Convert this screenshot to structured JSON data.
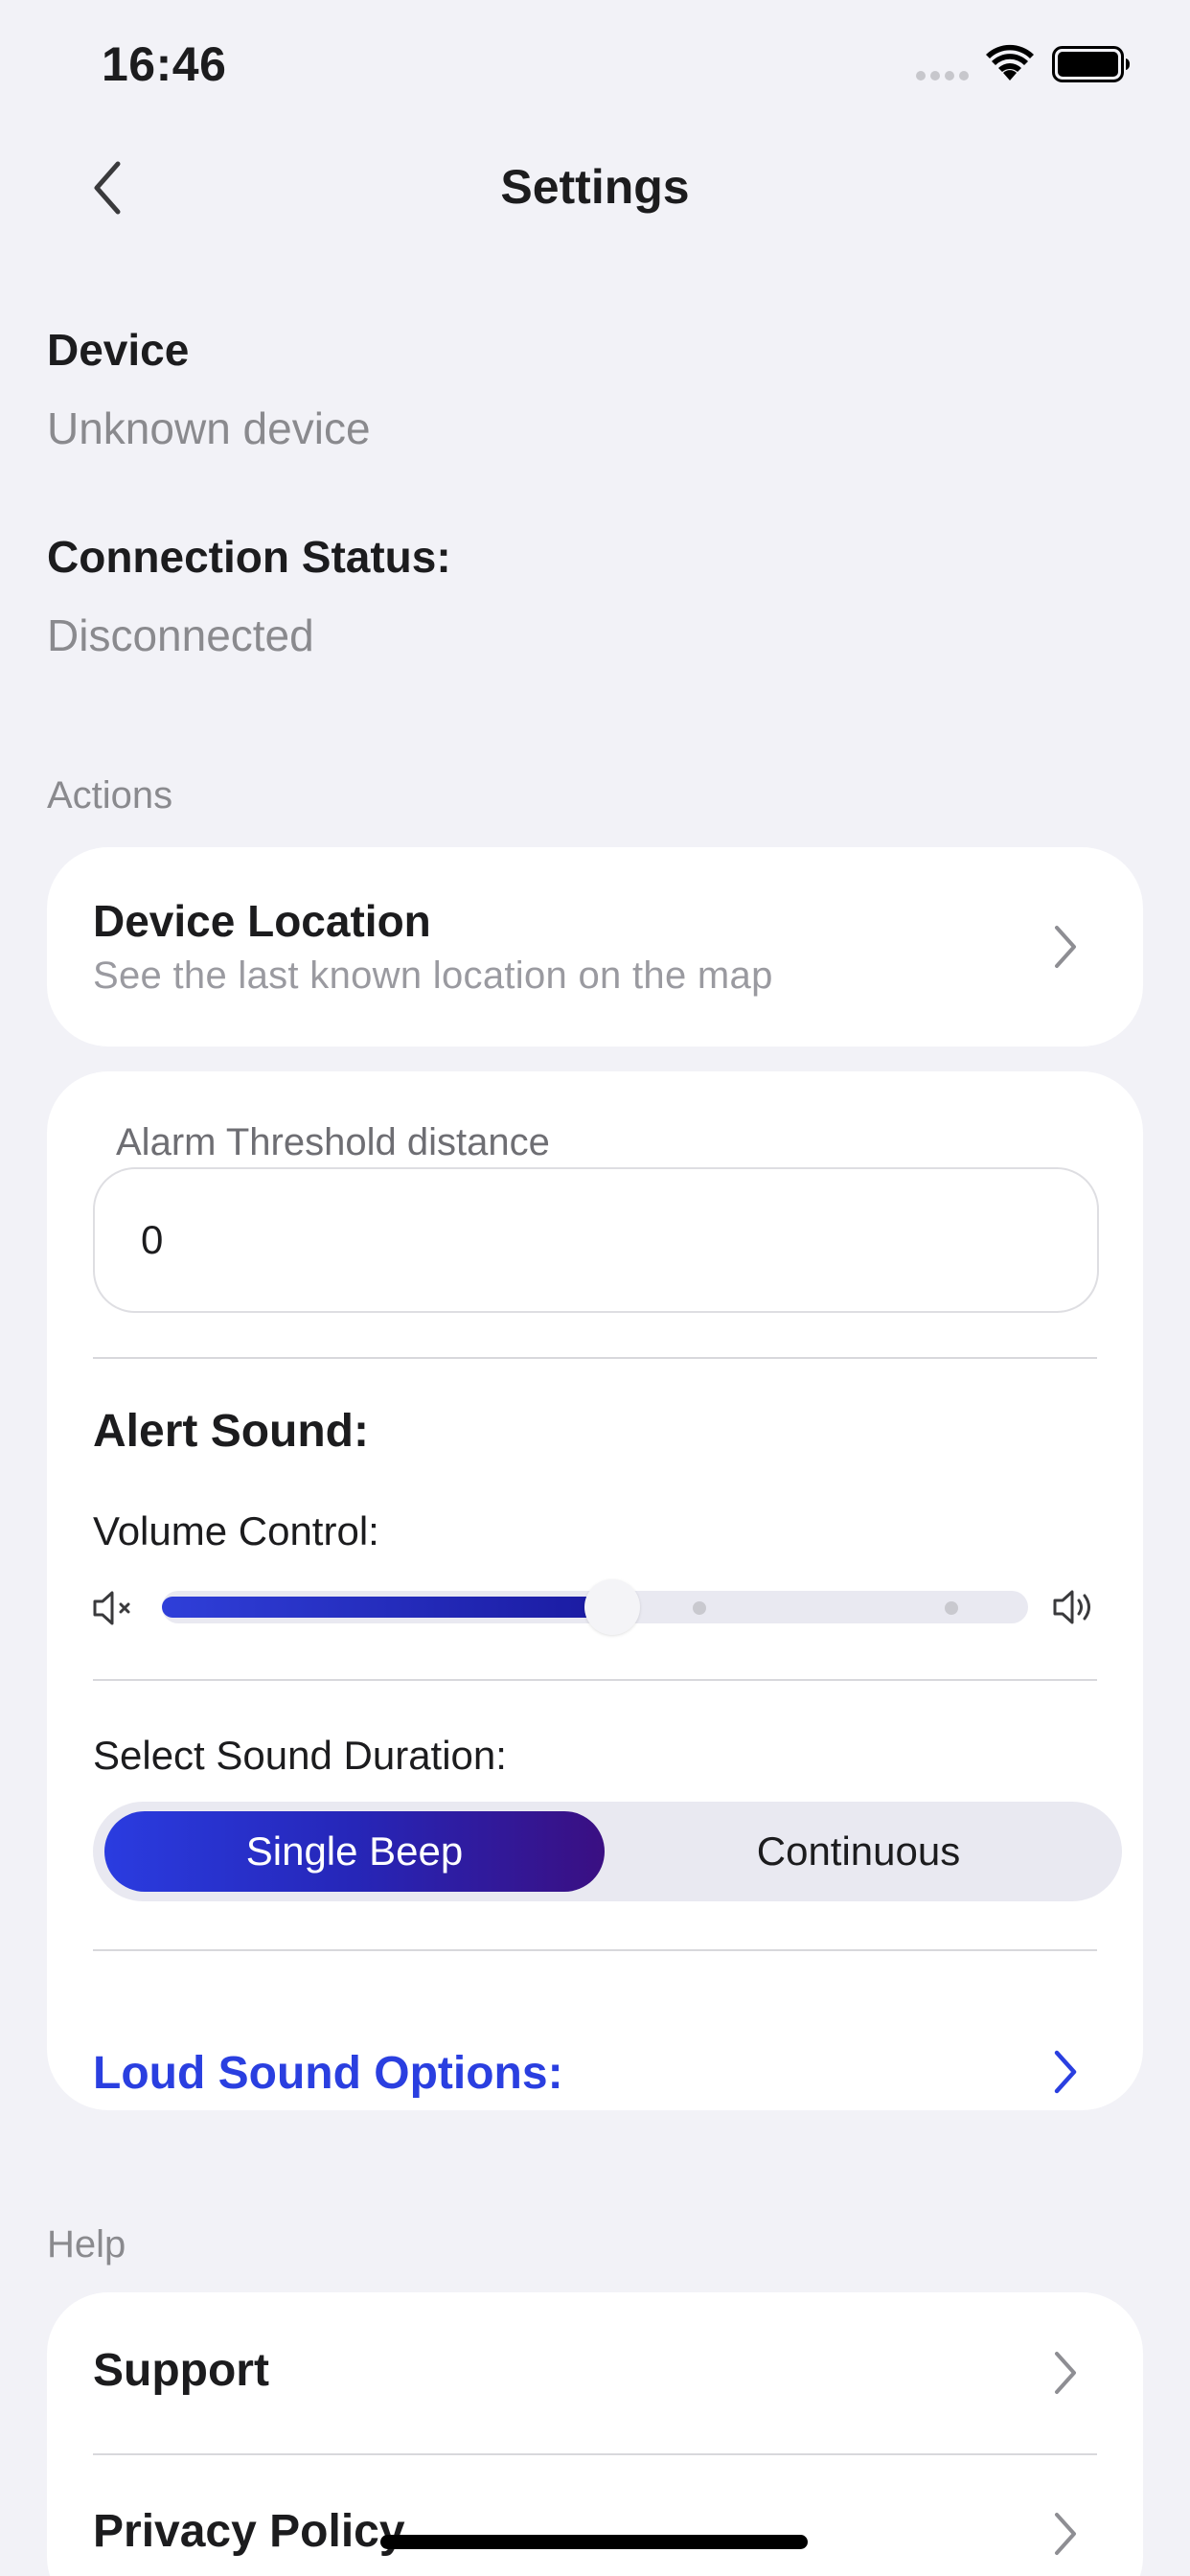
{
  "status_bar": {
    "time": "16:46"
  },
  "nav": {
    "title": "Settings"
  },
  "device": {
    "label": "Device",
    "value": "Unknown device"
  },
  "connection": {
    "label": "Connection Status:",
    "value": "Disconnected"
  },
  "actions": {
    "header": "Actions",
    "device_location": {
      "title": "Device Location",
      "subtitle": "See the last known location on the map"
    }
  },
  "alarm": {
    "threshold_label": "Alarm Threshold distance",
    "threshold_value": "0",
    "alert_sound_title": "Alert Sound:",
    "volume_label": "Volume Control:",
    "volume_level": 0.52,
    "duration_label": "Select Sound Duration:",
    "duration_options": [
      "Single Beep",
      "Continuous"
    ],
    "duration_selected": "Single Beep",
    "loud_sound_label": "Loud Sound Options:"
  },
  "help": {
    "header": "Help",
    "items": [
      {
        "label": "Support"
      },
      {
        "label": "Privacy Policy"
      }
    ]
  },
  "colors": {
    "accent": "#2a3fe0",
    "gradient_start": "#2a3ce0",
    "gradient_end": "#3a0f82",
    "background": "#f2f2f7",
    "secondary_text": "#8a8a8e"
  },
  "icons": [
    "wifi-icon",
    "battery-icon",
    "back-chevron-icon",
    "chevron-right-icon",
    "volume-mute-icon",
    "volume-high-icon"
  ]
}
